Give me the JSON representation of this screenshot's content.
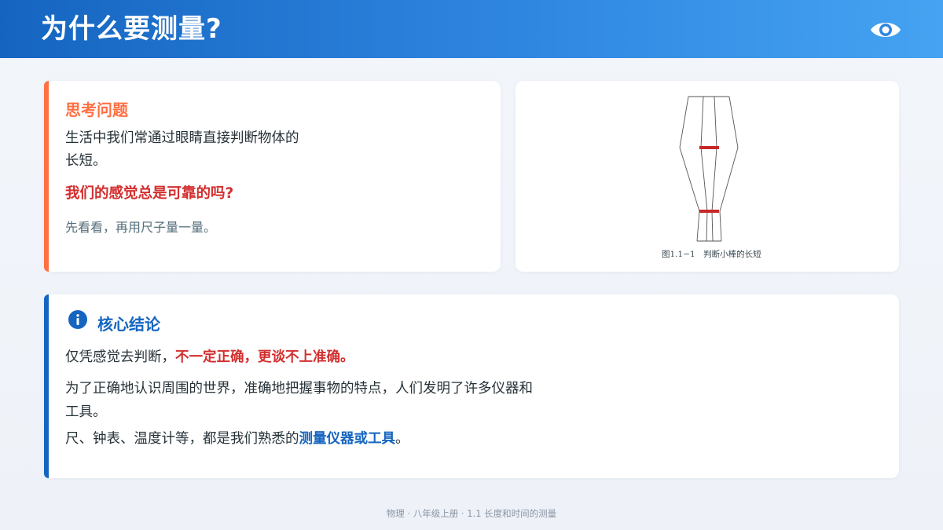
{
  "header": {
    "title": "为什么要测量?",
    "icon": "eye-icon"
  },
  "think_card": {
    "heading": "思考问题",
    "text": "生活中我们常通过眼睛直接判断物体的长短。",
    "question": "我们的感觉总是可靠的吗?",
    "hint": "先看看，再用尺子量一量。",
    "accent_color": "#ff7043"
  },
  "figure": {
    "caption": "图1.1−1　判断小棒的长短"
  },
  "conclusion": {
    "icon": "info-icon",
    "heading": "核心结论",
    "line1_prefix": "仅凭感觉去判断，",
    "line1_emphasis": "不一定正确，更谈不上准确。",
    "line2": "为了正确地认识周围的世界，准确地把握事物的特点，人们发明了许多仪器和工具。",
    "line3_prefix": "尺、钟表、温度计等，都是我们熟悉的",
    "line3_emphasis": "测量仪器或工具",
    "line3_suffix": "。",
    "accent_color": "#1565c0"
  },
  "footer": {
    "text": "物理 · 八年级上册 · 1.1 长度和时间的测量"
  }
}
